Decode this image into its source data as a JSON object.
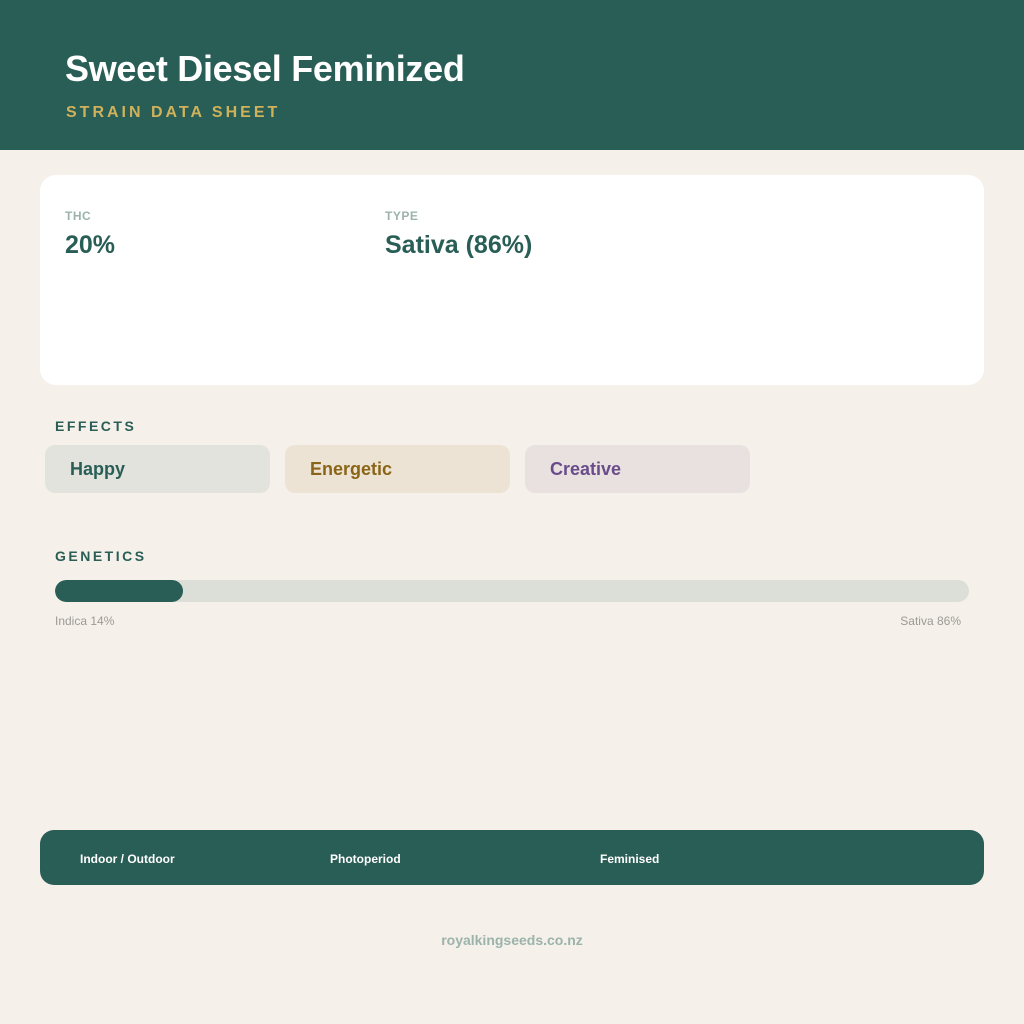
{
  "header": {
    "title": "Sweet Diesel Feminized",
    "subtitle": "STRAIN DATA SHEET"
  },
  "stats": [
    {
      "label": "THC",
      "value": "20%"
    },
    {
      "label": "TYPE",
      "value": "Sativa (86%)"
    }
  ],
  "effects": {
    "label": "EFFECTS",
    "items": [
      {
        "name": "Happy",
        "text_color": "#295e56",
        "bg_color": "#e2e3dc"
      },
      {
        "name": "Energetic",
        "text_color": "#8a6518",
        "bg_color": "#ece3d4"
      },
      {
        "name": "Creative",
        "text_color": "#6a4c8a",
        "bg_color": "#e8e1e0"
      }
    ]
  },
  "genetics": {
    "label": "GENETICS",
    "indica_percent": 14,
    "sativa_percent": 86,
    "indica_label": "Indica 14%",
    "sativa_label": "Sativa 86%"
  },
  "footer": {
    "items": [
      "Indoor / Outdoor",
      "Photoperiod",
      "Feminised"
    ]
  },
  "website": "royalkingseeds.co.nz",
  "colors": {
    "primary": "#295e56",
    "accent": "#d0b25a",
    "background": "#f5f0ea"
  }
}
